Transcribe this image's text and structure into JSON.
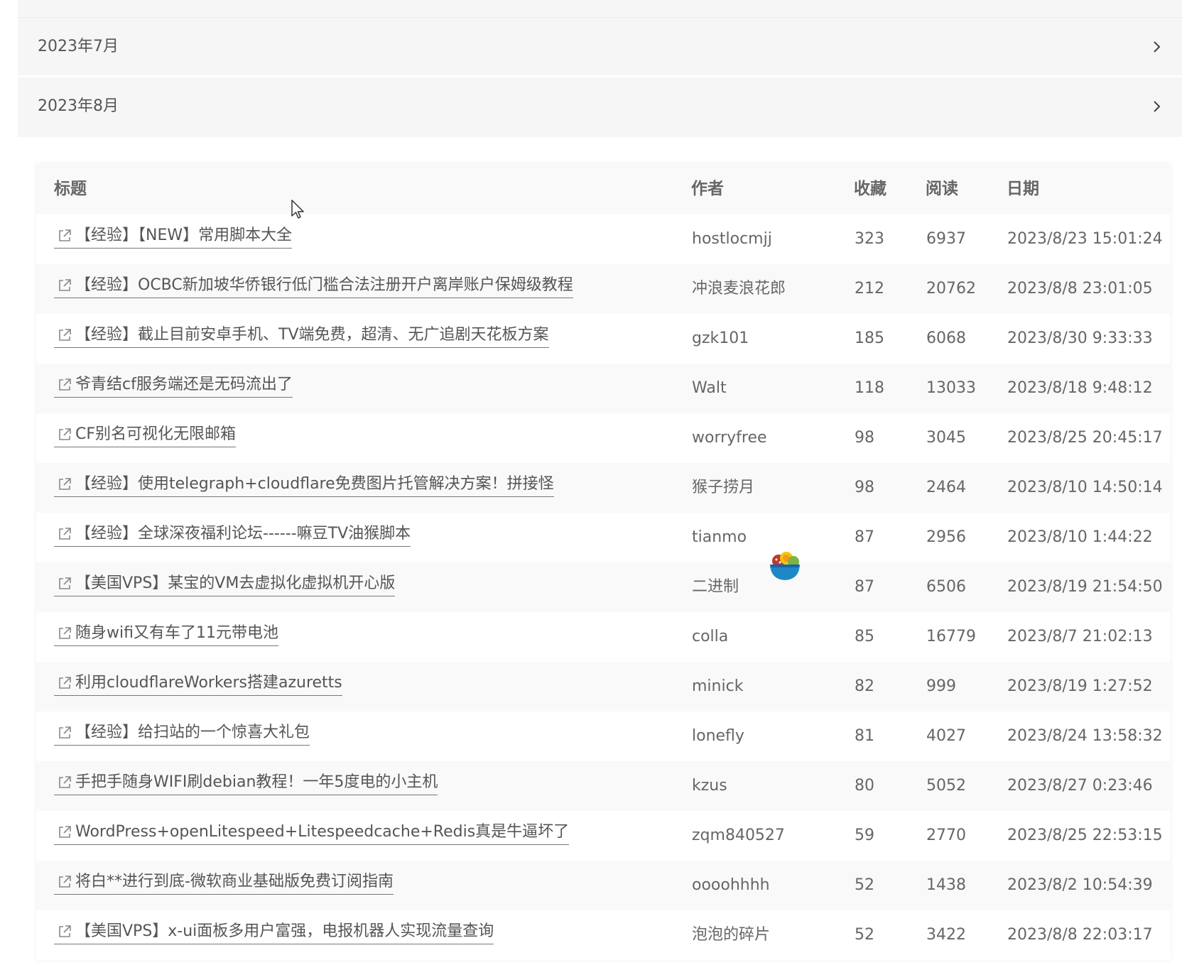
{
  "months": [
    {
      "label": "2023年7月"
    },
    {
      "label": "2023年8月"
    }
  ],
  "table": {
    "headers": {
      "title": "标题",
      "author": "作者",
      "fav": "收藏",
      "read": "阅读",
      "date": "日期"
    },
    "rows": [
      {
        "title": "【经验】【NEW】常用脚本大全",
        "author": "hostlocmjj",
        "fav": "323",
        "read": "6937",
        "date": "2023/8/23 15:01:24"
      },
      {
        "title": "【经验】OCBC新加坡华侨银行低门槛合法注册开户离岸账户保姆级教程",
        "author": "冲浪麦浪花郎",
        "fav": "212",
        "read": "20762",
        "date": "2023/8/8 23:01:05"
      },
      {
        "title": "【经验】截止目前安卓手机、TV端免费，超清、无广追剧天花板方案",
        "author": "gzk101",
        "fav": "185",
        "read": "6068",
        "date": "2023/8/30 9:33:33"
      },
      {
        "title": "爷青结cf服务端还是无码流出了",
        "author": "Walt",
        "fav": "118",
        "read": "13033",
        "date": "2023/8/18 9:48:12"
      },
      {
        "title": "CF别名可视化无限邮箱",
        "author": "worryfree",
        "fav": "98",
        "read": "3045",
        "date": "2023/8/25 20:45:17"
      },
      {
        "title": "【经验】使用telegraph+cloudflare免费图片托管解决方案！拼接怪",
        "author": "猴子捞月",
        "fav": "98",
        "read": "2464",
        "date": "2023/8/10 14:50:14"
      },
      {
        "title": "【经验】全球深夜福利论坛------嘛豆TV油猴脚本",
        "author": "tianmo",
        "fav": "87",
        "read": "2956",
        "date": "2023/8/10 1:44:22"
      },
      {
        "title": "【美国VPS】某宝的VM去虚拟化虚拟机开心版",
        "author": "二进制",
        "fav": "87",
        "read": "6506",
        "date": "2023/8/19 21:54:50"
      },
      {
        "title": "随身wifi又有车了11元带电池",
        "author": "colla",
        "fav": "85",
        "read": "16779",
        "date": "2023/8/7 21:02:13"
      },
      {
        "title": "利用cloudflareWorkers搭建azuretts",
        "author": "minick",
        "fav": "82",
        "read": "999",
        "date": "2023/8/19 1:27:52"
      },
      {
        "title": "【经验】给扫站的一个惊喜大礼包",
        "author": "lonefly",
        "fav": "81",
        "read": "4027",
        "date": "2023/8/24 13:58:32"
      },
      {
        "title": "手把手随身WIFI刷debian教程！一年5度电的小主机",
        "author": "kzus",
        "fav": "80",
        "read": "5052",
        "date": "2023/8/27 0:23:46"
      },
      {
        "title": "WordPress+openLitespeed+Litespeedcache+Redis真是牛逼坏了",
        "author": "zqm840527",
        "fav": "59",
        "read": "2770",
        "date": "2023/8/25 22:53:15"
      },
      {
        "title": "将白**进行到底-微软商业基础版免费订阅指南",
        "author": "oooohhhh",
        "fav": "52",
        "read": "1438",
        "date": "2023/8/2 10:54:39"
      },
      {
        "title": "【美国VPS】x-ui面板多用户富强，电报机器人实现流量查询",
        "author": "泡泡的碎片",
        "fav": "52",
        "read": "3422",
        "date": "2023/8/8 22:03:17"
      }
    ]
  },
  "icons": {
    "month_chevron": "chevron-right-icon",
    "row_link": "external-link-icon",
    "cursor": "mouse-cursor-icon",
    "floating_badge": "fruit-bowl-icon"
  },
  "colors": {
    "month_bg": "#f6f6f6",
    "header_bg": "#f9f9f9",
    "alt_row_bg": "#f9f9f9",
    "text": "#555555"
  }
}
